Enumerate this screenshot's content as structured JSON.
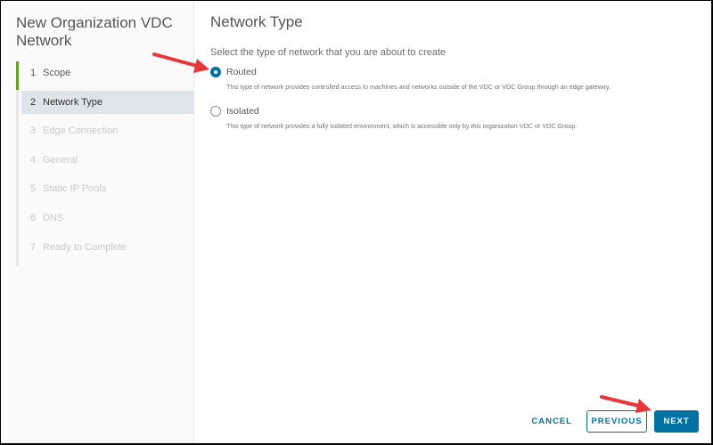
{
  "wizard": {
    "title": "New Organization VDC Network",
    "steps": [
      {
        "num": "1",
        "label": "Scope",
        "state": "done"
      },
      {
        "num": "2",
        "label": "Network Type",
        "state": "active"
      },
      {
        "num": "3",
        "label": "Edge Connection",
        "state": "disabled"
      },
      {
        "num": "4",
        "label": "General",
        "state": "disabled"
      },
      {
        "num": "5",
        "label": "Static IP Pools",
        "state": "disabled"
      },
      {
        "num": "6",
        "label": "DNS",
        "state": "disabled"
      },
      {
        "num": "7",
        "label": "Ready to Complete",
        "state": "disabled"
      }
    ]
  },
  "page": {
    "title": "Network Type",
    "instruction": "Select the type of network that you are about to create",
    "options": [
      {
        "label": "Routed",
        "selected": true,
        "description": "This type of network provides controlled access to machines and networks outside of the VDC or VDC Group through an edge gateway."
      },
      {
        "label": "Isolated",
        "selected": false,
        "description": "This type of network provides a fully isolated environment, which is accessible only by this organization VDC or VDC Group."
      }
    ]
  },
  "footer": {
    "cancel_label": "CANCEL",
    "previous_label": "PREVIOUS",
    "next_label": "NEXT"
  },
  "colors": {
    "accent": "#0072a3",
    "progress": "#62a420",
    "annotation_arrow": "#e8363b"
  }
}
